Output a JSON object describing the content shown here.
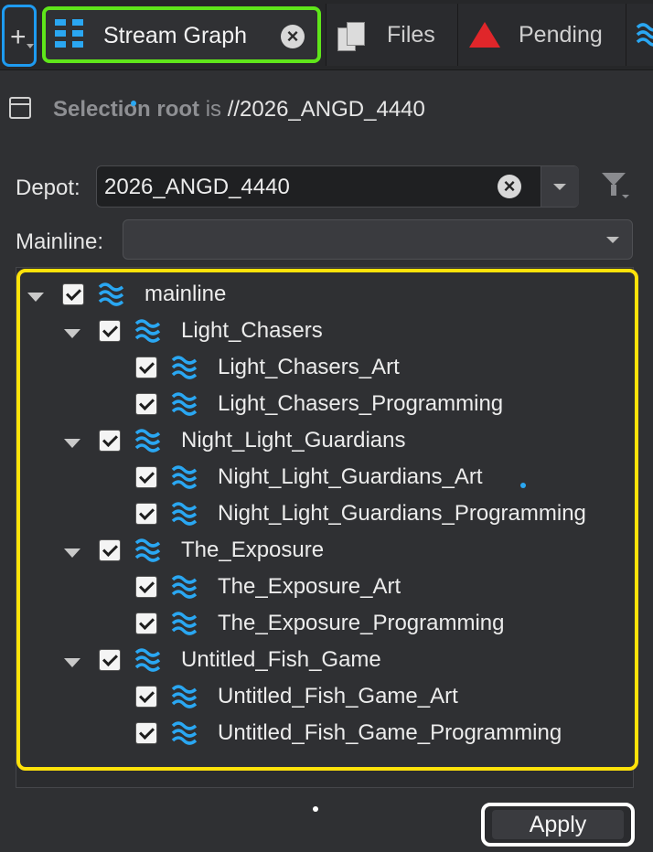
{
  "tabs": {
    "add_label": "+",
    "active": {
      "label": "Stream Graph",
      "close": "×"
    },
    "files": {
      "label": "Files"
    },
    "pending": {
      "label": "Pending"
    }
  },
  "selection_root": {
    "prefix": "Selection root",
    "connector": " is ",
    "path": "//2026_ANGD_4440"
  },
  "depot": {
    "label": "Depot:",
    "value": "2026_ANGD_4440",
    "clear": "×"
  },
  "mainline": {
    "label": "Mainline:",
    "value": ""
  },
  "tree": [
    {
      "name": "mainline",
      "level": 0,
      "expanded": true,
      "checked": true
    },
    {
      "name": "Light_Chasers",
      "level": 1,
      "expanded": true,
      "checked": true
    },
    {
      "name": "Light_Chasers_Art",
      "level": 2,
      "checked": true
    },
    {
      "name": "Light_Chasers_Programming",
      "level": 2,
      "checked": true
    },
    {
      "name": "Night_Light_Guardians",
      "level": 1,
      "expanded": true,
      "checked": true
    },
    {
      "name": "Night_Light_Guardians_Art",
      "level": 2,
      "checked": true
    },
    {
      "name": "Night_Light_Guardians_Programming",
      "level": 2,
      "checked": true
    },
    {
      "name": "The_Exposure",
      "level": 1,
      "expanded": true,
      "checked": true
    },
    {
      "name": "The_Exposure_Art",
      "level": 2,
      "checked": true
    },
    {
      "name": "The_Exposure_Programming",
      "level": 2,
      "checked": true
    },
    {
      "name": "Untitled_Fish_Game",
      "level": 1,
      "expanded": true,
      "checked": true
    },
    {
      "name": "Untitled_Fish_Game_Art",
      "level": 2,
      "checked": true
    },
    {
      "name": "Untitled_Fish_Game_Programming",
      "level": 2,
      "checked": true
    }
  ],
  "apply_label": "Apply",
  "colors": {
    "accent_blue": "#2aa7f2",
    "highlight_green": "#5fe61a",
    "highlight_yellow": "#ffe20a",
    "pending_red": "#e0262a"
  },
  "icons": {
    "stream": "stream-waves-icon",
    "graph": "grid-icon",
    "files": "documents-icon",
    "pending": "warning-triangle-icon",
    "filter": "filter-icon"
  }
}
